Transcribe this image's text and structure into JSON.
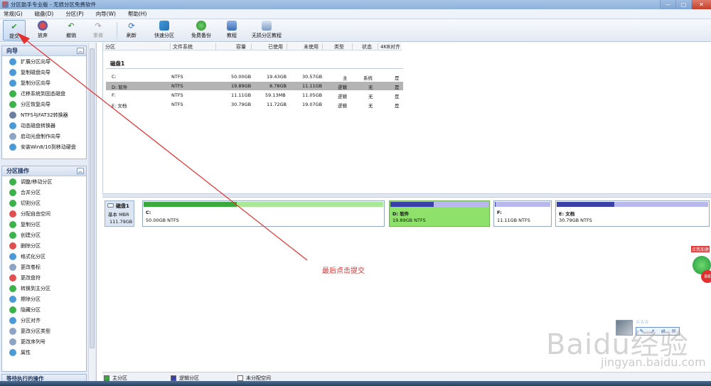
{
  "window": {
    "title": "分区助手专业版 - 无损分区免费软件",
    "controls": [
      "—",
      "□",
      "✕"
    ]
  },
  "menu": [
    "常规(G)",
    "磁盘(D)",
    "分区(P)",
    "向导(W)",
    "帮助(H)"
  ],
  "toolbar": {
    "submit": "提交",
    "discard": "放弃",
    "undo": "撤销",
    "redo": "重做",
    "refresh": "刷新",
    "quick_partition": "快速分区",
    "free_backup": "免费备份",
    "tutorial": "教程",
    "lossless_tutorial": "无损分区教程"
  },
  "sidebar": {
    "wizard_title": "向导",
    "wizard_items": [
      "扩展分区向导",
      "复制磁盘向导",
      "复制分区向导",
      "迁移系统到固态磁盘",
      "分区恢复向导",
      "NTFS与FAT32转换器",
      "动态磁盘转换器",
      "启动光盘制作向导",
      "安装Win8/10到移动硬盘"
    ],
    "ops_title": "分区操作",
    "ops_items": [
      "调整/移动分区",
      "合并分区",
      "切割分区",
      "分配自由空间",
      "复制分区",
      "创建分区",
      "删除分区",
      "格式化分区",
      "更改卷标",
      "更改盘符",
      "转换到主分区",
      "擦除分区",
      "隐藏分区",
      "分区对齐",
      "更改分区类型",
      "更改序列号",
      "属性"
    ],
    "pending_title": "等待执行的操作"
  },
  "table": {
    "headers": [
      "分区",
      "文件系统",
      "容量",
      "已使用",
      "未使用",
      "类型",
      "状态",
      "4KB对齐"
    ],
    "disk_label": "磁盘1",
    "rows": [
      [
        "C:",
        "NTFS",
        "50.00GB",
        "19.43GB",
        "30.57GB",
        "主",
        "系统",
        "是"
      ],
      [
        "D: 软件",
        "NTFS",
        "19.89GB",
        "8.78GB",
        "11.11GB",
        "逻辑",
        "无",
        "是"
      ],
      [
        "F:",
        "NTFS",
        "11.11GB",
        "59.13MB",
        "11.05GB",
        "逻辑",
        "无",
        "是"
      ],
      [
        "E: 文档",
        "NTFS",
        "30.79GB",
        "11.72GB",
        "19.07GB",
        "逻辑",
        "无",
        "是"
      ]
    ]
  },
  "disk_map": {
    "disk_name": "磁盘1",
    "disk_type": "基本 MBR",
    "disk_size": "111.79GB",
    "partitions": [
      {
        "name": "C:",
        "info": "50.00GB NTFS",
        "used_fraction": 0.39
      },
      {
        "name": "D: 软件",
        "info": "19.89GB NTFS",
        "used_fraction": 0.44
      },
      {
        "name": "F:",
        "info": "11.11GB NTFS",
        "used_fraction": 0.01
      },
      {
        "name": "E: 文档",
        "info": "30.79GB NTFS",
        "used_fraction": 0.38
      }
    ]
  },
  "annotation": "最后点击提交",
  "legend": [
    "主分区",
    "逻辑分区",
    "未分配空间"
  ],
  "overlay": {
    "badge": "点我加速",
    "badge_value": "88",
    "watermark": "Baidu经验",
    "watermark_url": "jingyan.baidu.com"
  },
  "colors": {
    "primary_bar": "#3aa83a",
    "logical_bar": "#3b3fa8",
    "selected_part": "#8ee26b",
    "annotation": "#e53030"
  }
}
